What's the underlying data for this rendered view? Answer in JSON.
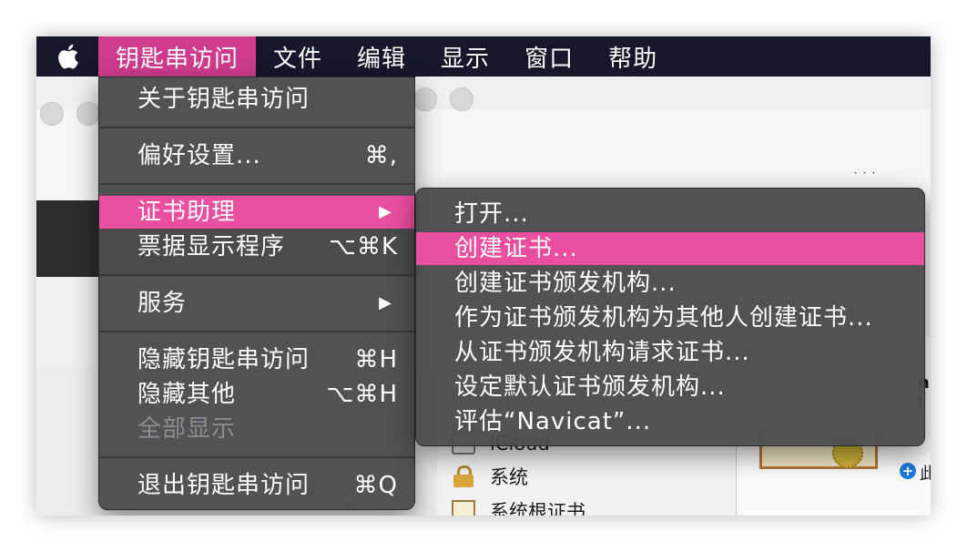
{
  "menubar": {
    "apple_icon": "apple-logo-icon",
    "items": [
      {
        "label": "钥匙串访问",
        "active": true
      },
      {
        "label": "文件"
      },
      {
        "label": "编辑"
      },
      {
        "label": "显示"
      },
      {
        "label": "窗口"
      },
      {
        "label": "帮助"
      }
    ]
  },
  "app_menu": {
    "items": [
      {
        "label": "关于钥匙串访问",
        "shortcut": ""
      },
      {
        "label": "偏好设置...",
        "shortcut": "⌘,"
      },
      {
        "label": "证书助理",
        "submenu_arrow": "▶",
        "highlighted": true
      },
      {
        "label": "票据显示程序",
        "shortcut": "⌥⌘K"
      },
      {
        "label": "服务",
        "submenu_arrow": "▶"
      },
      {
        "label": "隐藏钥匙串访问",
        "shortcut": "⌘H"
      },
      {
        "label": "隐藏其他",
        "shortcut": "⌥⌘H"
      },
      {
        "label": "全部显示",
        "disabled": true
      },
      {
        "label": "退出钥匙串访问",
        "shortcut": "⌘Q"
      }
    ]
  },
  "cert_submenu": {
    "items": [
      {
        "label": "打开..."
      },
      {
        "label": "创建证书...",
        "highlighted": true
      },
      {
        "label": "创建证书颁发机构..."
      },
      {
        "label": "作为证书颁发机构为其他人创建证书..."
      },
      {
        "label": "从证书颁发机构请求证书..."
      },
      {
        "label": "设定默认证书颁发机构..."
      },
      {
        "label": "评估“Navicat”..."
      }
    ]
  },
  "background": {
    "sidebar": [
      {
        "label": "iCloud",
        "icon": "icloud-icon"
      },
      {
        "label": "系统",
        "icon": "lock-icon"
      },
      {
        "label": "系统根证书",
        "icon": "certificate-icon"
      }
    ],
    "right_peek_text": "此",
    "colors": {
      "menubar": "#17172b",
      "active_menu": "#cf3c8d",
      "menu_bg": "#4c4c50",
      "highlight": "#e94e9f",
      "disabled_text": "#8e8e92"
    }
  }
}
